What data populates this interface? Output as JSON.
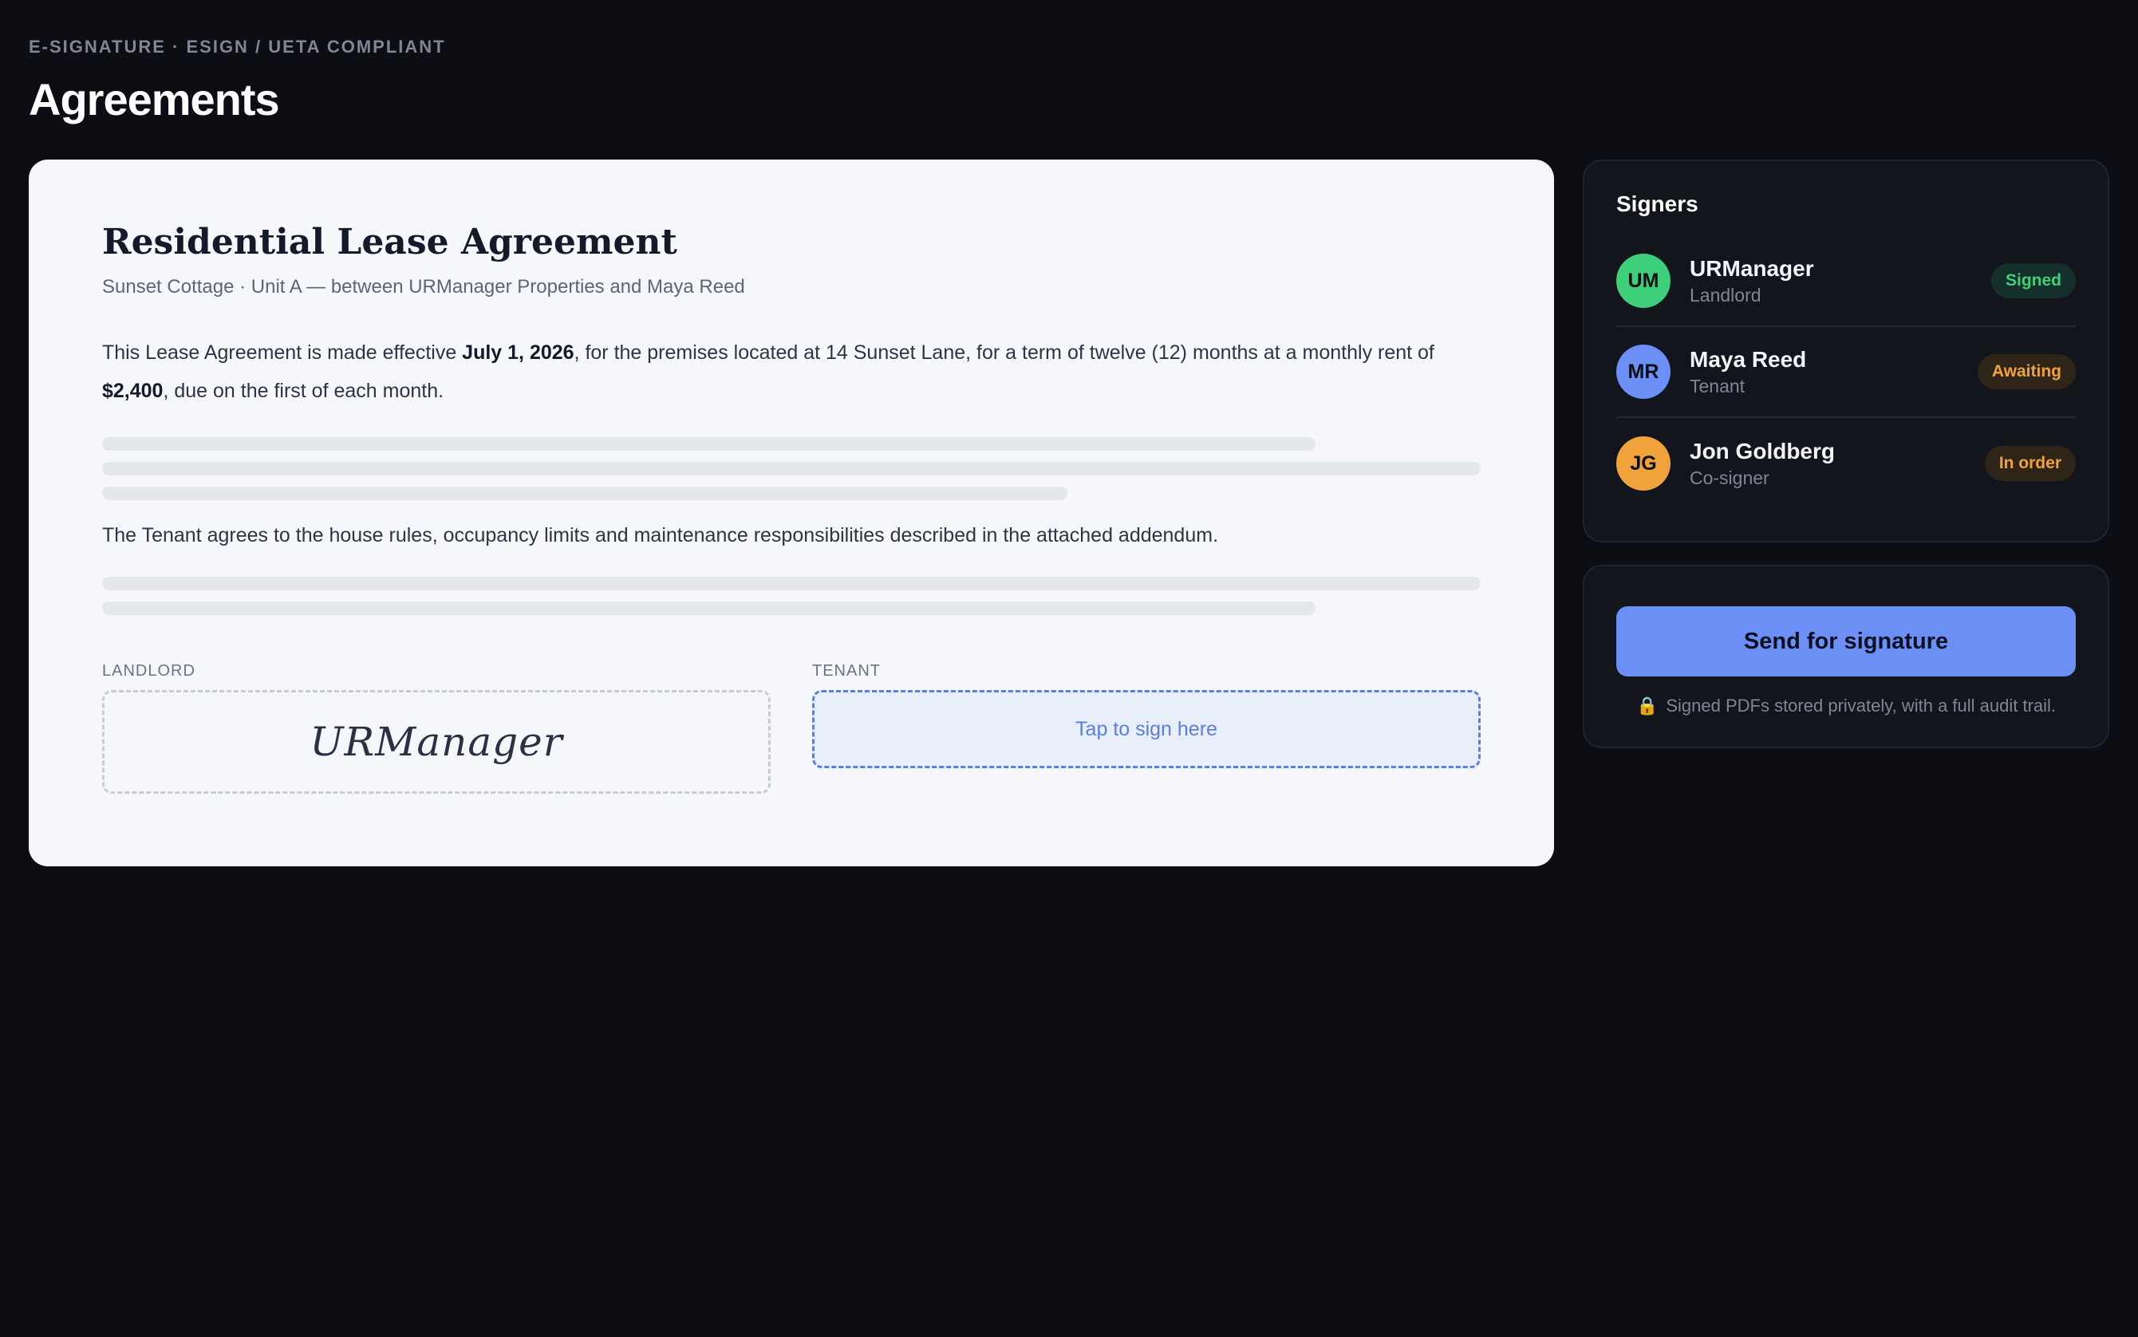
{
  "header": {
    "eyebrow": "E-SIGNATURE · ESIGN / UETA COMPLIANT",
    "title": "Agreements"
  },
  "document": {
    "title": "Residential Lease Agreement",
    "subtitle": "Sunset Cottage · Unit A — between URManager Properties and Maya Reed",
    "para1": {
      "t1": "This Lease Agreement is made effective ",
      "date": "July 1, 2026",
      "t2": ", for the premises located at 14 Sunset Lane, for a term of twelve (12) months at a monthly rent of ",
      "rent": "$2,400",
      "t3": ", due on the first of each month."
    },
    "para2": "The Tenant agrees to the house rules, occupancy limits and maintenance responsibilities described in the attached addendum.",
    "signatures": {
      "landlord_label": "LANDLORD",
      "landlord_signature": "URManager",
      "tenant_label": "TENANT",
      "tenant_prompt": "Tap to sign here"
    }
  },
  "signers": {
    "title": "Signers",
    "items": [
      {
        "initials": "UM",
        "name": "URManager",
        "role": "Landlord",
        "status": "Signed",
        "avatar_color": "#3ecf7a",
        "status_color": "#3ecf7a",
        "status_bg": "#15302a"
      },
      {
        "initials": "MR",
        "name": "Maya Reed",
        "role": "Tenant",
        "status": "Awaiting",
        "avatar_color": "#6b8ff5",
        "status_color": "#f0a23b",
        "status_bg": "#2e2518"
      },
      {
        "initials": "JG",
        "name": "Jon Goldberg",
        "role": "Co-signer",
        "status": "In order",
        "avatar_color": "#f0a23b",
        "status_color": "#f0a23b",
        "status_bg": "#2e2518"
      }
    ]
  },
  "actions": {
    "send_label": "Send for signature",
    "note": "Signed PDFs stored privately, with a full audit trail.",
    "note_icon": "lock-icon"
  }
}
